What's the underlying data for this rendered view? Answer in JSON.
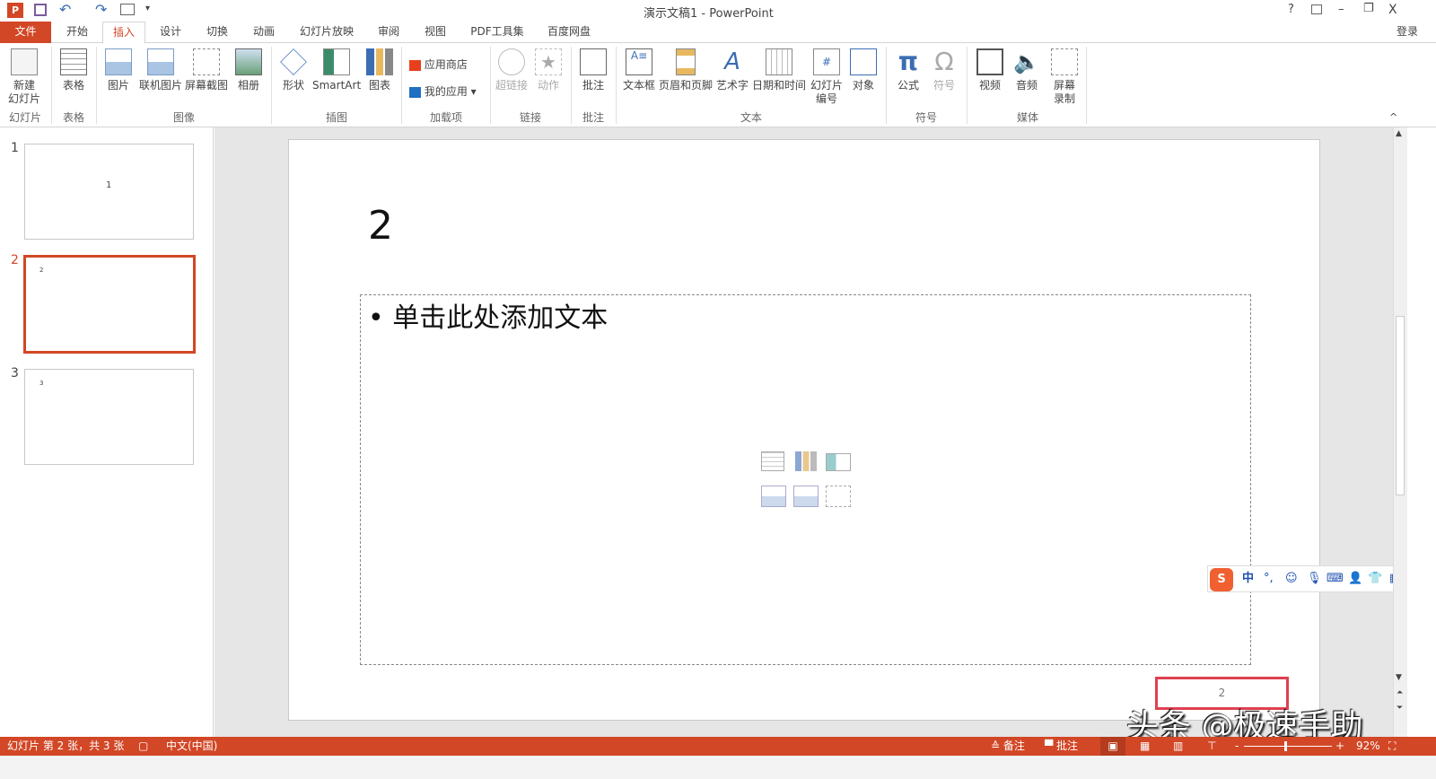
{
  "window": {
    "title": "演示文稿1 - PowerPoint",
    "help": "?",
    "minimize": "–",
    "restore": "❐",
    "close": "X",
    "login": "登录"
  },
  "qat": {
    "customize": "▾"
  },
  "tabs": [
    "文件",
    "开始",
    "插入",
    "设计",
    "切换",
    "动画",
    "幻灯片放映",
    "审阅",
    "视图",
    "PDF工具集",
    "百度网盘"
  ],
  "ribbon": {
    "buttons": {
      "new_slide": "新建\n幻灯片",
      "table": "表格",
      "picture": "图片",
      "online_picture": "联机图片",
      "screenshot": "屏幕截图",
      "album": "相册",
      "shapes": "形状",
      "smartart": "SmartArt",
      "chart": "图表",
      "store": "应用商店",
      "my_apps": "我的应用",
      "hyperlink": "超链接",
      "action": "动作",
      "comment": "批注",
      "textbox": "文本框",
      "header_footer": "页眉和页脚",
      "wordart": "艺术字",
      "datetime": "日期和时间",
      "slide_number": "幻灯片\n编号",
      "object": "对象",
      "equation": "公式",
      "symbol": "符号",
      "video": "视频",
      "audio": "音频",
      "screen_record": "屏幕\n录制"
    },
    "groups": {
      "slides": "幻灯片",
      "tables": "表格",
      "images": "图像",
      "illustrations": "插图",
      "addins": "加载项",
      "links": "链接",
      "comments": "批注",
      "text": "文本",
      "symbols": "符号",
      "media": "媒体"
    }
  },
  "thumbnails": [
    {
      "num": "1",
      "text": "1"
    },
    {
      "num": "2",
      "text": "2"
    },
    {
      "num": "3",
      "text": "3"
    }
  ],
  "slide": {
    "title": "2",
    "bullet": "单击此处添加文本",
    "slide_number": "2"
  },
  "ime": {
    "chinese": "中",
    "punct": "°,"
  },
  "watermark": "头条 @极速手助",
  "status": {
    "slide_info": "幻灯片 第 2 张，共 3 张",
    "language": "中文(中国)",
    "notes": "备注",
    "comments": "批注",
    "zoom": "92%",
    "zoom_fraction": 0.46
  },
  "colors": {
    "accent": "#d24726"
  }
}
